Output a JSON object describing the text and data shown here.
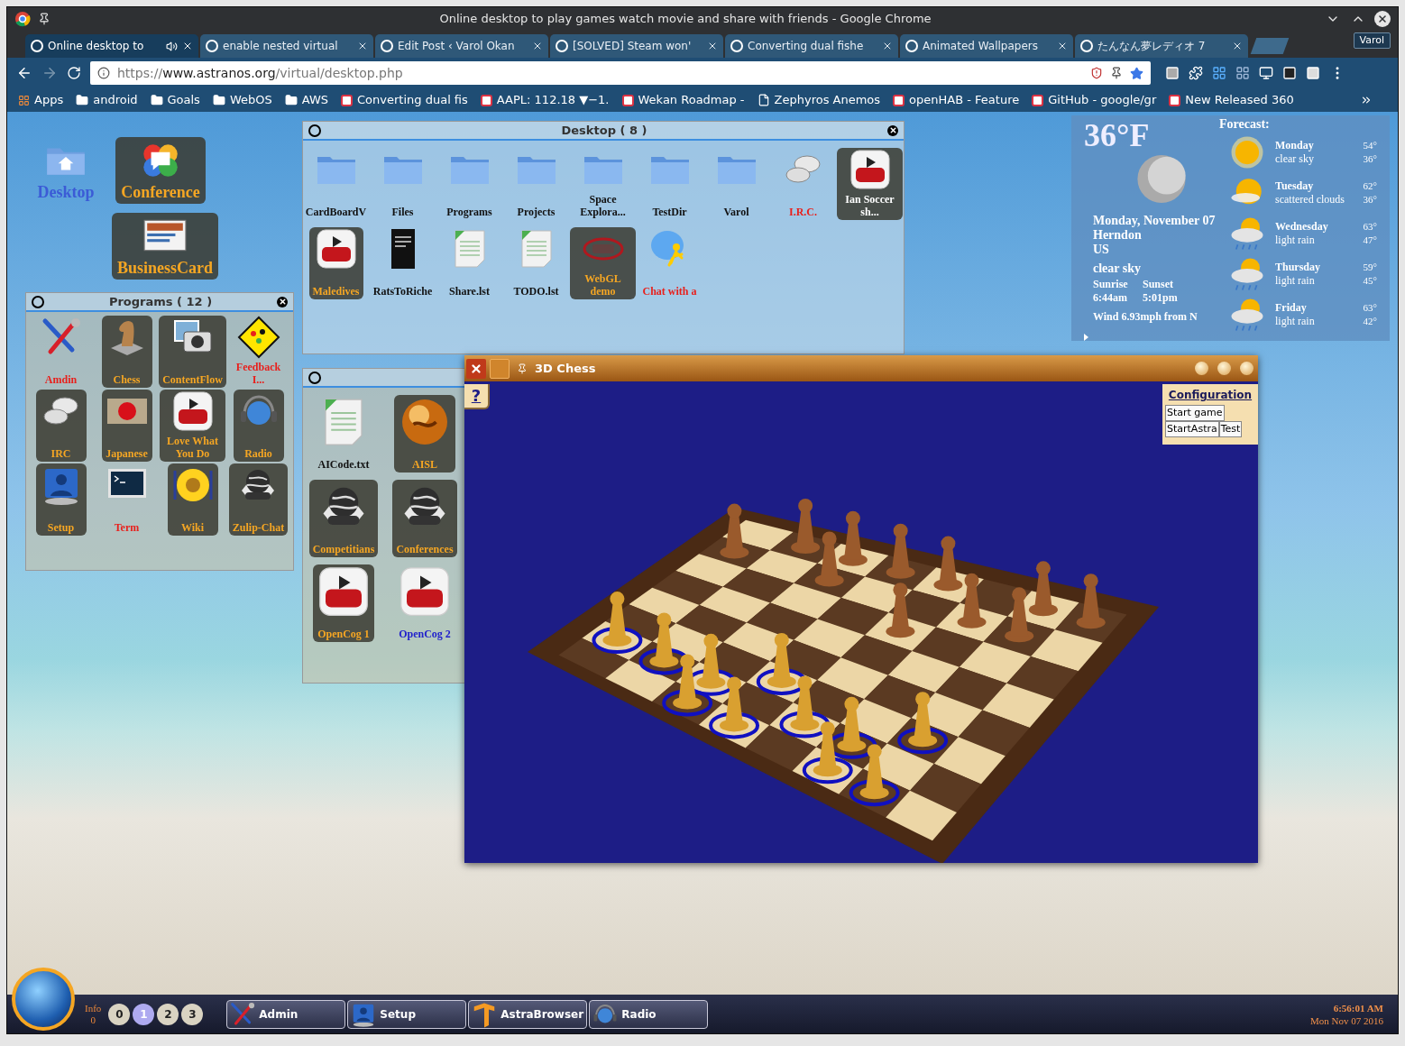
{
  "window": {
    "title": "Online desktop to play games watch movie and share with friends - Google Chrome"
  },
  "tabs": [
    {
      "label": "Online desktop to",
      "selected": true,
      "audio": true
    },
    {
      "label": "enable nested virtual",
      "selected": false,
      "audio": false
    },
    {
      "label": "Edit Post ‹ Varol Okan",
      "selected": false,
      "audio": false
    },
    {
      "label": "[SOLVED] Steam won'",
      "selected": false,
      "audio": false
    },
    {
      "label": "Converting dual fishe",
      "selected": false,
      "audio": false
    },
    {
      "label": "Animated Wallpapers",
      "selected": false,
      "audio": false
    },
    {
      "label": "たんなん夢レディオ 7",
      "selected": false,
      "audio": false
    }
  ],
  "profile": "Varol",
  "address": {
    "scheme": "https://",
    "host": "www.astranos.org",
    "path": "/virtual/desktop.php"
  },
  "bookmarks": [
    {
      "label": "Apps",
      "kind": "apps"
    },
    {
      "label": "android",
      "kind": "folder"
    },
    {
      "label": "Goals",
      "kind": "folder"
    },
    {
      "label": "WebOS",
      "kind": "folder"
    },
    {
      "label": "AWS",
      "kind": "folder"
    },
    {
      "label": "Converting dual fis",
      "kind": "site"
    },
    {
      "label": "AAPL: 112.18 ▼−1.",
      "kind": "site"
    },
    {
      "label": "Wekan Roadmap -",
      "kind": "site"
    },
    {
      "label": "Zephyros Anemos",
      "kind": "page"
    },
    {
      "label": "openHAB - Feature",
      "kind": "site"
    },
    {
      "label": "GitHub - google/gr",
      "kind": "site"
    },
    {
      "label": "New Released 360",
      "kind": "site"
    }
  ],
  "desktop_icons": [
    {
      "label": "Desktop",
      "kind": "home",
      "color": "#3b5bd6"
    },
    {
      "label": "Conference",
      "kind": "conference",
      "color": "#f5a623"
    },
    {
      "label": "BusinessCard",
      "kind": "card",
      "color": "#f5a623"
    }
  ],
  "programs_window": {
    "title": "Programs ( 12 )",
    "items": [
      {
        "label": "Amdin",
        "kind": "tools",
        "color": "#e8201c"
      },
      {
        "label": "Chess",
        "kind": "chess",
        "color": "#f5a623"
      },
      {
        "label": "ContentFlow",
        "kind": "camera",
        "color": "#f5a623"
      },
      {
        "label": "Feedback I...",
        "kind": "issues",
        "color": "#e8201c"
      },
      {
        "label": "IRC",
        "kind": "chat",
        "color": "#f5a623"
      },
      {
        "label": "Japanese",
        "kind": "flag",
        "color": "#f5a623"
      },
      {
        "label": "Love What You Do",
        "kind": "video",
        "color": "#f5a623"
      },
      {
        "label": "Radio",
        "kind": "radio",
        "color": "#f5a623"
      },
      {
        "label": "Setup",
        "kind": "setup",
        "color": "#f5a623"
      },
      {
        "label": "Term",
        "kind": "terminal",
        "color": "#e8201c"
      },
      {
        "label": "Wiki",
        "kind": "sunflower",
        "color": "#f5a623"
      },
      {
        "label": "Zulip-Chat",
        "kind": "html",
        "color": "#f5a623"
      }
    ]
  },
  "desktop_window": {
    "title": "Desktop ( 8 )",
    "items": [
      {
        "label": "CardBoardV",
        "kind": "folder",
        "color": "#111111"
      },
      {
        "label": "Files",
        "kind": "folder",
        "color": "#111111"
      },
      {
        "label": "Programs",
        "kind": "folder",
        "color": "#111111"
      },
      {
        "label": "Projects",
        "kind": "folder",
        "color": "#111111"
      },
      {
        "label": "Space Explora...",
        "kind": "folder",
        "color": "#111111"
      },
      {
        "label": "TestDir",
        "kind": "folder",
        "color": "#111111"
      },
      {
        "label": "Varol",
        "kind": "folder",
        "color": "#111111"
      },
      {
        "label": "I.R.C.",
        "kind": "chat",
        "color": "#e8201c"
      },
      {
        "label": "Ian Soccer sh...",
        "kind": "video",
        "color": "#ffffff"
      },
      {
        "label": "Maledives",
        "kind": "video",
        "color": "#f5a623"
      },
      {
        "label": "RatsToRiche",
        "kind": "book",
        "color": "#111111"
      },
      {
        "label": "Share.lst",
        "kind": "textfile",
        "color": "#111111"
      },
      {
        "label": "TODO.lst",
        "kind": "textfile",
        "color": "#111111"
      },
      {
        "label": "WebGL demo",
        "kind": "webgl",
        "color": "#f5a623"
      },
      {
        "label": "Chat with a",
        "kind": "aim",
        "color": "#e8201c"
      }
    ]
  },
  "folder_window": {
    "items": [
      {
        "label": "AICode.txt",
        "kind": "textfile",
        "color": "#111111"
      },
      {
        "label": "AISL",
        "kind": "globe",
        "color": "#f5a623"
      },
      {
        "label": "Competitians",
        "kind": "html",
        "color": "#f5a623"
      },
      {
        "label": "Conferences",
        "kind": "html",
        "color": "#f5a623"
      },
      {
        "label": "OpenCog 1",
        "kind": "video",
        "color": "#f5a623"
      },
      {
        "label": "OpenCog 2",
        "kind": "video",
        "color": "#2222cc"
      }
    ]
  },
  "chess_window": {
    "title": "3D Chess",
    "help": "?",
    "config_link": "Configuration",
    "buttons": [
      "Start game",
      "StartAstra",
      "Test"
    ]
  },
  "weather": {
    "temperature": "36°F",
    "forecast_label": "Forecast:",
    "date": "Monday, November 07",
    "city": "Herndon",
    "country": "US",
    "condition": "clear sky",
    "sunrise_label": "Sunrise",
    "sunset_label": "Sunset",
    "sunrise": "6:44am",
    "sunset": "5:01pm",
    "wind": "Wind 6.93mph from N",
    "forecast": [
      {
        "day": "Monday",
        "desc": "clear sky",
        "high": "54°",
        "low": "36°",
        "kind": "sun"
      },
      {
        "day": "Tuesday",
        "desc": "scattered clouds",
        "high": "62°",
        "low": "36°",
        "kind": "cloudsun"
      },
      {
        "day": "Wednesday",
        "desc": "light rain",
        "high": "63°",
        "low": "47°",
        "kind": "rain"
      },
      {
        "day": "Thursday",
        "desc": "light rain",
        "high": "59°",
        "low": "45°",
        "kind": "rain"
      },
      {
        "day": "Friday",
        "desc": "light rain",
        "high": "63°",
        "low": "42°",
        "kind": "rain"
      }
    ]
  },
  "taskbar": {
    "info_label": "Info",
    "info_count": "0",
    "workspaces": [
      {
        "label": "0",
        "selected": false
      },
      {
        "label": "1",
        "selected": true
      },
      {
        "label": "2",
        "selected": false
      },
      {
        "label": "3",
        "selected": false
      }
    ],
    "tasks": [
      {
        "label": "Admin",
        "kind": "tools"
      },
      {
        "label": "Setup",
        "kind": "setup"
      },
      {
        "label": "AstraBrowser",
        "kind": "astra"
      },
      {
        "label": "Radio",
        "kind": "radio"
      }
    ],
    "time": "6:56:01 AM",
    "date": "Mon Nov 07 2016"
  }
}
